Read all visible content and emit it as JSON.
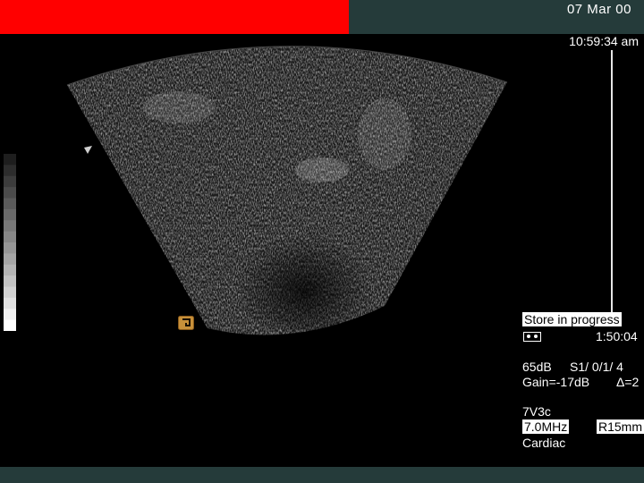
{
  "header": {
    "date": "07 Mar 00",
    "time": "10:59:34 am",
    "record_color": "#ff0000",
    "bar_color": "#253b3a"
  },
  "status": {
    "store_label": "Store in progress",
    "tape_icon": "tape-icon",
    "store_time": "1:50:04"
  },
  "settings": {
    "dynamic_range": "65dB",
    "s_setting": "S1/ 0/1/ 4",
    "gain": "Gain=-17dB",
    "delta": "Δ=2"
  },
  "probe": {
    "transducer": "7V3c",
    "frequency": "7.0MHz",
    "range": "R15mm",
    "mode": "Cardiac"
  },
  "markers": {
    "orientation_icon": "orientation-marker-icon",
    "pointer_icon": "depth-pointer-icon"
  }
}
